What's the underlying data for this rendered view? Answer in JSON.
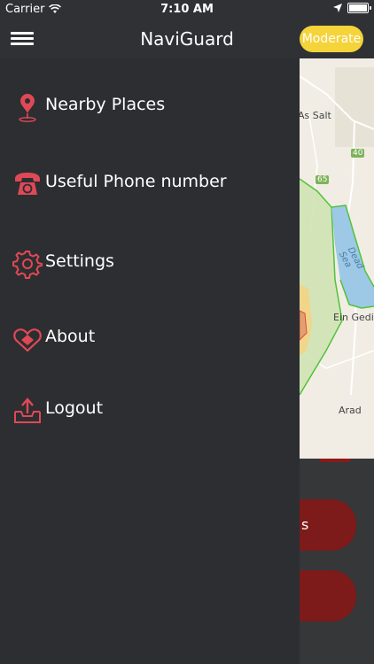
{
  "status_bar": {
    "carrier": "Carrier",
    "time": "7:10 AM"
  },
  "header": {
    "title": "NaviGuard",
    "level_badge": "Moderate"
  },
  "drawer": {
    "items": [
      {
        "label": "Nearby Places",
        "icon": "map-pin-icon"
      },
      {
        "label": "Useful Phone number",
        "icon": "telephone-icon"
      },
      {
        "label": "Settings",
        "icon": "gear-icon"
      },
      {
        "label": "About",
        "icon": "heart-shield-icon"
      },
      {
        "label": "Logout",
        "icon": "upload-tray-icon"
      }
    ]
  },
  "map": {
    "labels": {
      "as_salt": "As Salt",
      "dead_sea": "Dead Sea",
      "ein_gedi": "Ein Gedi",
      "arad": "Arad"
    },
    "road_badges": {
      "r40": "40",
      "r65": "65"
    }
  },
  "bottom": {
    "action_1_text_fragment": "s"
  },
  "colors": {
    "accent": "#e04856",
    "badge": "#f5d33a",
    "drawer_bg": "#2c2e31",
    "button_red": "#7d1a1a"
  }
}
